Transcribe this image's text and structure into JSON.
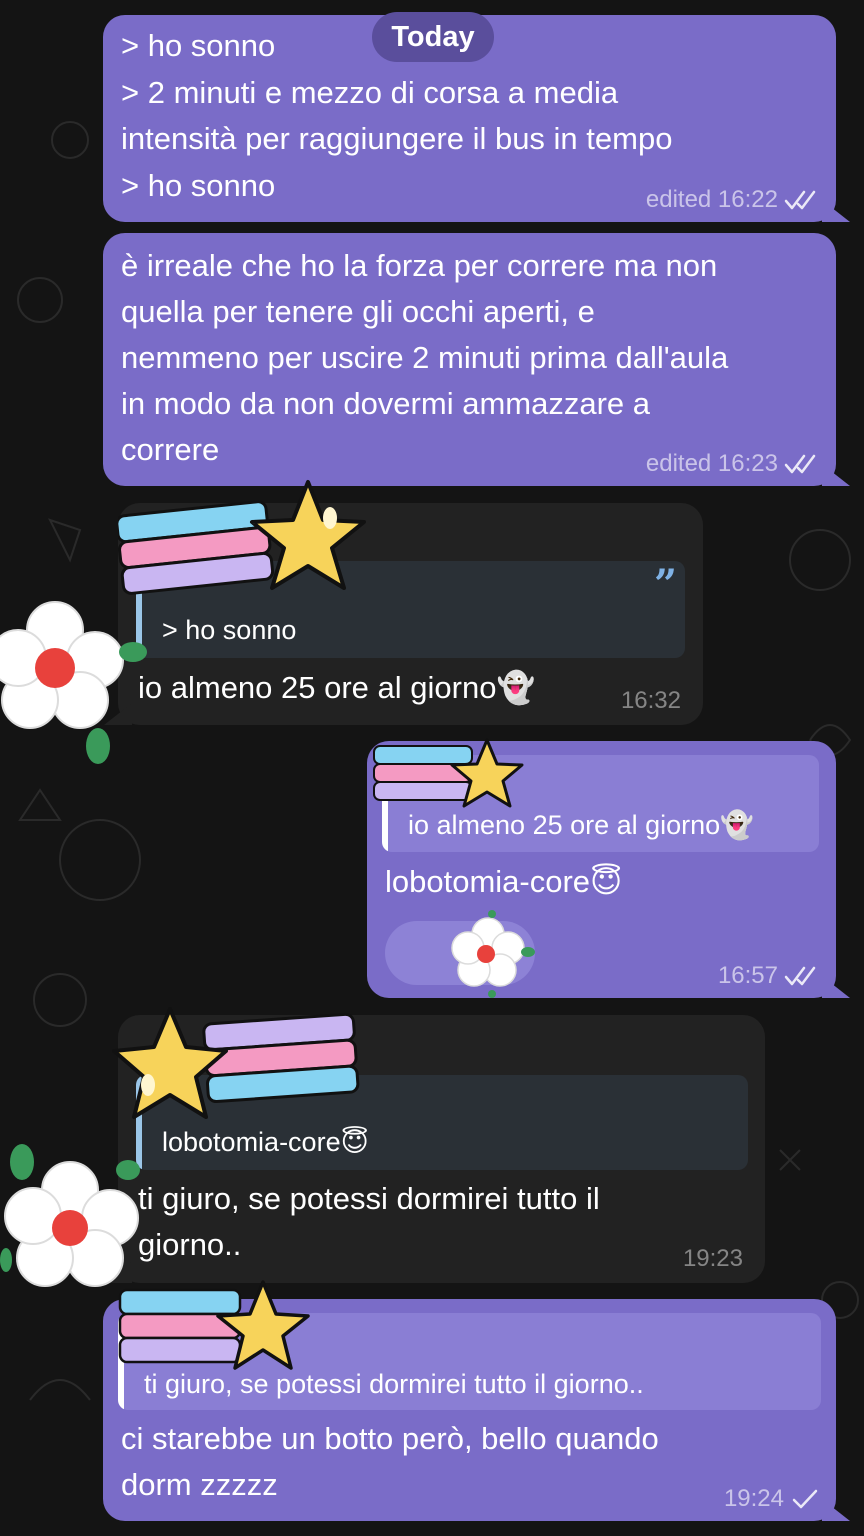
{
  "date_divider": "Today",
  "ghost_emoji": "👻",
  "halo_emoji": "😇",
  "messages": [
    {
      "direction": "outgoing",
      "lines": [
        "> ho sonno",
        "> 2 minuti e mezzo di corsa a media",
        "intensità per raggiungere il bus in tempo",
        "> ho sonno"
      ],
      "meta": "edited 16:22",
      "status": "read"
    },
    {
      "direction": "outgoing",
      "lines": [
        "è irreale che ho la forza per correre ma non",
        "quella per tenere gli occhi aperti, e",
        "nemmeno per uscire 2 minuti prima dall'aula",
        "in modo da non dovermi ammazzare a",
        "correre"
      ],
      "meta": "edited 16:23",
      "status": "read"
    },
    {
      "direction": "incoming",
      "reply_to": "> ho sonno",
      "text": "io almeno 25 ore al giorno",
      "meta": "16:32"
    },
    {
      "direction": "outgoing",
      "reply_to": "io almeno 25 ore al giorno",
      "text": "lobotomia-core",
      "meta": "16:57",
      "status": "read"
    },
    {
      "direction": "incoming",
      "reply_to": "lobotomia-core",
      "lines": [
        "ti giuro, se potessi dormirei tutto il",
        "giorno.."
      ],
      "meta": "19:23"
    },
    {
      "direction": "outgoing",
      "reply_to": "ti giuro, se potessi dormirei tutto il giorno..",
      "lines": [
        "ci starebbe un botto però, bello quando",
        "dorm zzzzz"
      ],
      "meta": "19:24",
      "status": "sent"
    }
  ],
  "colors": {
    "background": "#141414",
    "outgoing_bubble": "#7a6cc8",
    "incoming_bubble": "#222222",
    "date_pill": "#5a4e9c",
    "reply_bar_incoming": "#9bc6e8"
  },
  "icons": [
    "double-check-icon",
    "single-check-icon",
    "quote-icon",
    "shooting-star-sticker",
    "flower-sticker"
  ]
}
